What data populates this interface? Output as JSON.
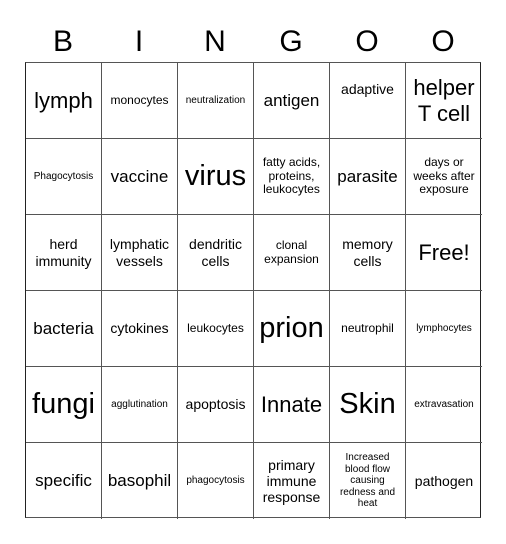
{
  "header": {
    "letters": [
      "B",
      "I",
      "N",
      "G",
      "O",
      "O"
    ]
  },
  "cells": [
    [
      "lymph",
      "monocytes",
      "neutralization",
      "antigen",
      "adaptive",
      "helper T cell"
    ],
    [
      "Phagocytosis",
      "vaccine",
      "virus",
      "fatty acids, proteins, leukocytes",
      "parasite",
      "days or weeks after exposure"
    ],
    [
      "herd immunity",
      "lymphatic vessels",
      "dendritic cells",
      "clonal expansion",
      "memory cells",
      "Free!"
    ],
    [
      "bacteria",
      "cytokines",
      "leukocytes",
      "prion",
      "neutrophil",
      "lymphocytes"
    ],
    [
      "fungi",
      "agglutination",
      "apoptosis",
      "Innate",
      "Skin",
      "extravasation"
    ],
    [
      "specific",
      "basophil",
      "phagocytosis",
      "primary immune response",
      "Increased blood flow causing redness and heat",
      "pathogen"
    ]
  ]
}
